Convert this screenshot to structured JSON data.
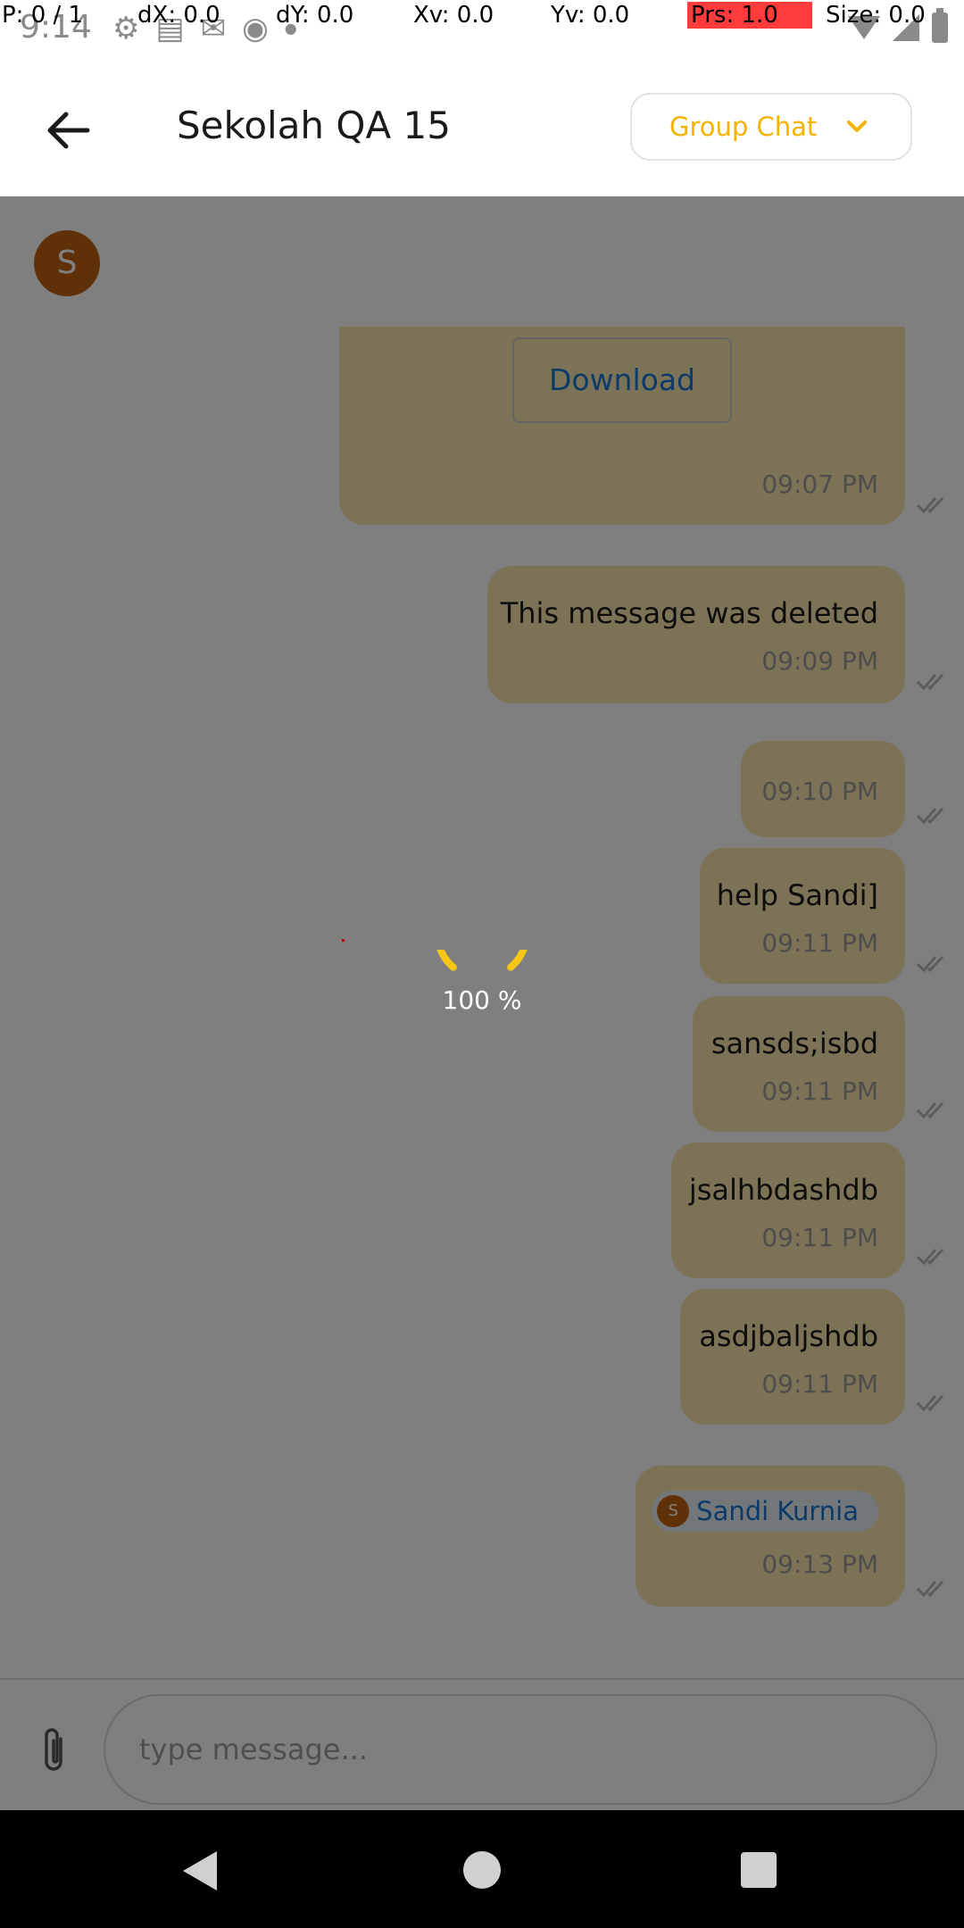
{
  "status_bar": {
    "time": "9:14"
  },
  "pointer_overlay": {
    "p": "P: 0 / 1",
    "dx": "dX: 0.0",
    "dy": "dY: 0.0",
    "xv": "Xv: 0.0",
    "yv": "Yv: 0.0",
    "prs": "Prs: 1.0",
    "size": "Size: 0.0"
  },
  "header": {
    "title": "Sekolah QA 15",
    "chat_type": "Group Chat"
  },
  "info_bar": {
    "avatar_letter": "S"
  },
  "messages": [
    {
      "download_label": "Download",
      "time": "09:07 PM"
    },
    {
      "text": "This message was deleted",
      "time": "09:09 PM"
    },
    {
      "text": "",
      "time": "09:10 PM"
    },
    {
      "text": "help Sandi]",
      "time": "09:11 PM"
    },
    {
      "text": "sansds;isbd",
      "time": "09:11 PM"
    },
    {
      "text": "jsalhbdashdb",
      "time": "09:11 PM"
    },
    {
      "text": "asdjbaljshdb",
      "time": "09:11 PM"
    },
    {
      "mention": "Sandi Kurnia",
      "mention_avatar_letter": "S",
      "time": "09:13 PM"
    }
  ],
  "input": {
    "placeholder": "type message..."
  },
  "loading": {
    "label": "100 %",
    "progress_percent": 100
  },
  "colors": {
    "accent": "#f5b300",
    "bubble": "#f8e7ad",
    "link": "#1976d2",
    "avatar": "#c06010"
  }
}
